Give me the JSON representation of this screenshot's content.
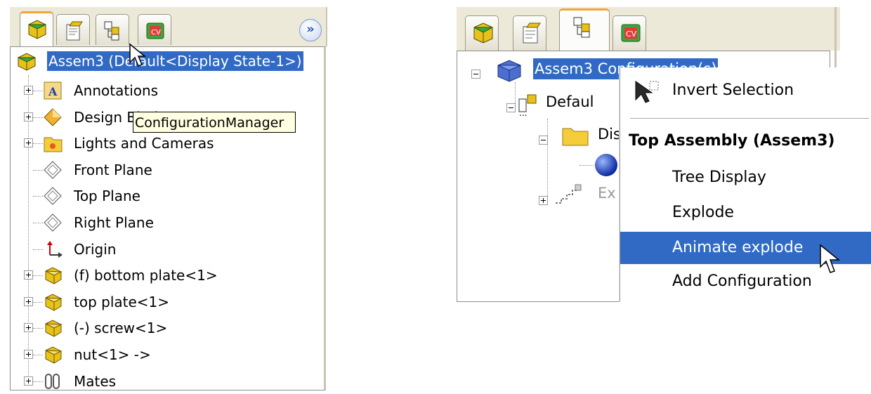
{
  "left": {
    "tabs": [
      "FeatureManager",
      "PropertyManager",
      "ConfigurationManager",
      "DimXpertManager"
    ],
    "expand_label": "»",
    "root_label": "Assem3  (Default<Display State-1>)",
    "tooltip": "ConfigurationManager",
    "items": [
      {
        "label": "Annotations",
        "icon": "annotations-icon"
      },
      {
        "label": "Design Binder",
        "icon": "design-binder-icon"
      },
      {
        "label": "Lights and Cameras",
        "icon": "lights-cameras-icon"
      },
      {
        "label": "Front Plane",
        "icon": "plane-icon"
      },
      {
        "label": "Top Plane",
        "icon": "plane-icon"
      },
      {
        "label": "Right Plane",
        "icon": "plane-icon"
      },
      {
        "label": "Origin",
        "icon": "origin-icon"
      },
      {
        "label": "(f) bottom plate<1>",
        "icon": "part-icon"
      },
      {
        "label": "top plate<1>",
        "icon": "part-icon"
      },
      {
        "label": "(-) screw<1>",
        "icon": "part-icon"
      },
      {
        "label": "nut<1> ->",
        "icon": "part-icon"
      },
      {
        "label": "Mates",
        "icon": "mates-icon"
      }
    ]
  },
  "right": {
    "tabs": [
      "FeatureManager",
      "PropertyManager",
      "ConfigurationManager",
      "DimXpertManager"
    ],
    "root_label": "Assem3 Configuration(s)",
    "child_default": "Defaul",
    "child_display": "Dis",
    "child_explode": "Ex",
    "context_menu": {
      "invert_selection": "Invert Selection",
      "header": "Top Assembly (Assem3)",
      "tree_display": "Tree Display",
      "explode": "Explode",
      "animate_explode": "Animate explode",
      "add_configuration": "Add Configuration"
    }
  },
  "colors": {
    "selection": "#316ac5",
    "tooltip_bg": "#ffffe1",
    "tab_accent": "#f2a43a",
    "panel_bg": "#ece9d8"
  }
}
